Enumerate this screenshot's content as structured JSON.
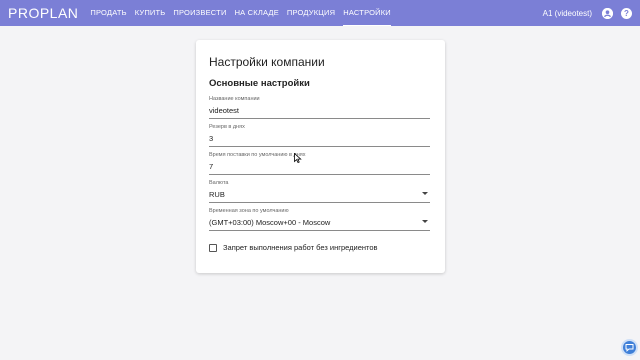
{
  "brand": "PROPLAN",
  "nav": {
    "items": [
      {
        "label": "ПРОДАТЬ"
      },
      {
        "label": "КУПИТЬ"
      },
      {
        "label": "ПРОИЗВЕСТИ"
      },
      {
        "label": "НА СКЛАДЕ"
      },
      {
        "label": "ПРОДУКЦИЯ"
      },
      {
        "label": "НАСТРОЙКИ"
      }
    ],
    "active": "НАСТРОЙКИ"
  },
  "user": {
    "label": "A1 (videotest)"
  },
  "icons": {
    "account": "account-circle-icon",
    "help": "help-circle-icon",
    "chat": "chat-bubble-icon"
  },
  "colors": {
    "topbar": "#7b7fd6",
    "fab": "#3f7fd8"
  },
  "settings": {
    "title": "Настройки компании",
    "section": "Основные настройки",
    "fields": {
      "company_name": {
        "label": "Название компании",
        "value": "videotest"
      },
      "reserve_days": {
        "label": "Резерв в днях",
        "value": "3"
      },
      "delivery_time": {
        "label": "Время поставки по умолчанию в днях",
        "value": "7"
      },
      "currency": {
        "label": "Валюта",
        "value": "RUB"
      },
      "timezone": {
        "label": "Временная зона по умолчанию",
        "value": "(GMT+03:00) Moscow+00 - Moscow"
      }
    },
    "checkbox": {
      "label": "Запрет выполнения работ без ингредиентов",
      "checked": false
    }
  }
}
